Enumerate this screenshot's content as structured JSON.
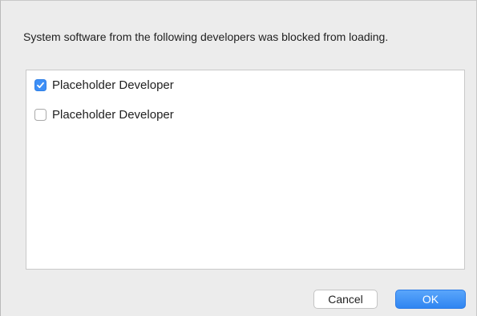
{
  "dialog": {
    "message": "System software from the following developers was blocked from loading.",
    "developers": [
      {
        "label": "Placeholder Developer",
        "checked": true
      },
      {
        "label": "Placeholder Developer",
        "checked": false
      }
    ],
    "cancel_label": "Cancel",
    "ok_label": "OK"
  },
  "colors": {
    "accent": "#3d8ff6",
    "dialog_background": "#ececec",
    "list_background": "#ffffff"
  },
  "icons": {
    "checked_box": "checkmark-icon"
  }
}
